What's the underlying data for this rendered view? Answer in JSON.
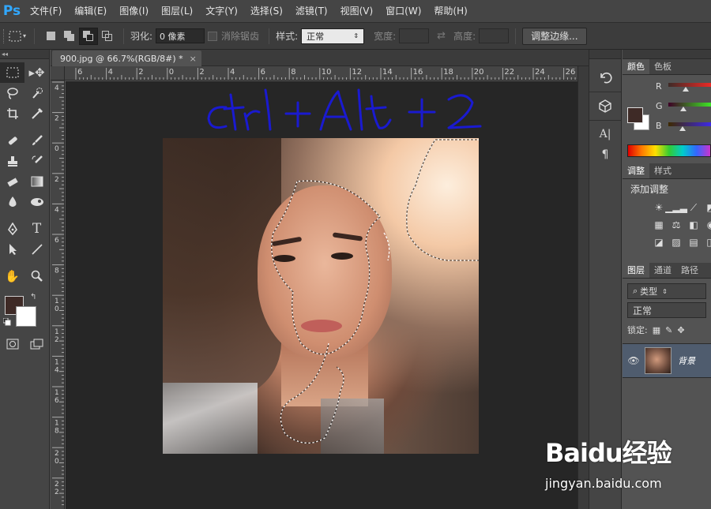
{
  "app": {
    "logo": "Ps"
  },
  "menu": [
    "文件(F)",
    "编辑(E)",
    "图像(I)",
    "图层(L)",
    "文字(Y)",
    "选择(S)",
    "滤镜(T)",
    "视图(V)",
    "窗口(W)",
    "帮助(H)"
  ],
  "options": {
    "feather_label": "羽化:",
    "feather_value": "0 像素",
    "antialias_label": "消除锯齿",
    "style_label": "样式:",
    "style_value": "正常",
    "width_label": "宽度:",
    "height_label": "高度:",
    "refine_edge_button": "调整边缘..."
  },
  "document": {
    "tab_title": "900.jpg @ 66.7%(RGB/8#) *",
    "tab_close": "×",
    "annotation_text": "ctrl + Alt + 2"
  },
  "ruler_top": [
    "6",
    "4",
    "2",
    "0",
    "2",
    "4",
    "6",
    "8",
    "10",
    "12",
    "14",
    "16",
    "18",
    "20",
    "22",
    "24",
    "26"
  ],
  "ruler_left": [
    "4",
    "2",
    "0",
    "2",
    "4",
    "6",
    "8",
    "10",
    "12",
    "14",
    "16",
    "18",
    "20",
    "22"
  ],
  "colors": {
    "foreground": "#3e2a26",
    "background": "#ffffff",
    "accent": "#31a8ff",
    "canvas_bg": "#262626"
  },
  "panels": {
    "color_tabs": [
      "颜色",
      "色板"
    ],
    "channels": [
      "R",
      "G",
      "B"
    ],
    "adjust_tabs": [
      "调整",
      "样式"
    ],
    "adjust_title": "添加调整",
    "layers_tabs": [
      "图层",
      "通道",
      "路径"
    ],
    "filter_label": "类型",
    "blend_mode": "正常",
    "lock_label": "锁定:",
    "layer_name": "背景"
  },
  "watermark": {
    "main": "Baidu经验",
    "sub": "jingyan.baidu.com"
  }
}
